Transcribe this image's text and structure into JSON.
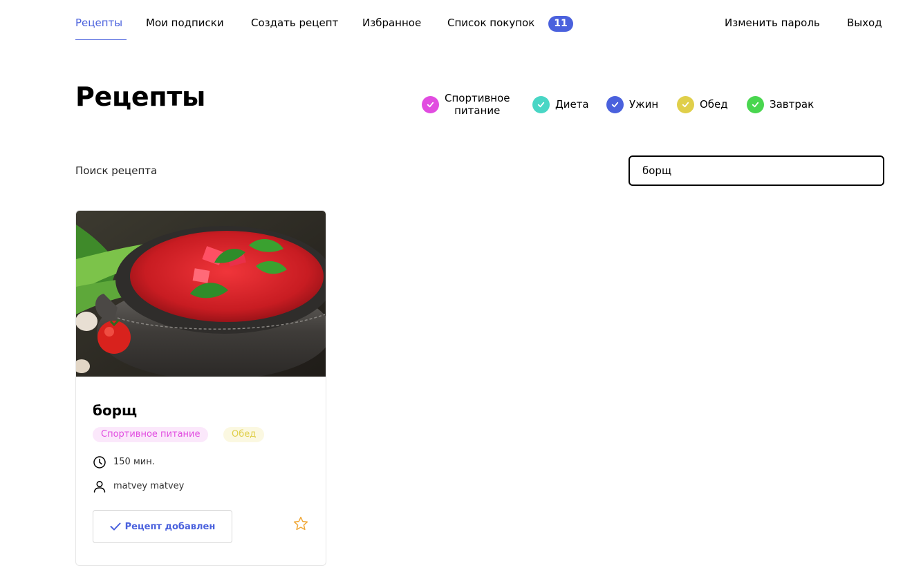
{
  "nav": {
    "recipes": "Рецепты",
    "subscriptions": "Мои подписки",
    "create_recipe": "Создать рецепт",
    "favorites": "Избранное",
    "shopping_list": "Список покупок",
    "shopping_count": "11",
    "change_password": "Изменить пароль",
    "logout": "Выход"
  },
  "page": {
    "title": "Рецепты"
  },
  "tags": [
    {
      "label_line1": "Спортивное",
      "label_line2": "питание",
      "color": "#e14ce0",
      "checked": true
    },
    {
      "label": "Диета",
      "color": "#49d6c5",
      "checked": true
    },
    {
      "label": "Ужин",
      "color": "#4a61dd",
      "checked": true
    },
    {
      "label": "Обед",
      "color": "#e0cf4a",
      "checked": true
    },
    {
      "label": "Завтрак",
      "color": "#49d64f",
      "checked": true
    }
  ],
  "search": {
    "label": "Поиск рецепта",
    "value": "борщ"
  },
  "recipe": {
    "title": "борщ",
    "tags": [
      "Спортивное питание",
      "Обед"
    ],
    "time": "150 мин.",
    "author": "matvey matvey",
    "added_label": "Рецепт добавлен",
    "image_icon": "borscht-photo"
  },
  "colors": {
    "accent": "#4a61dd",
    "star": "#f0a93a"
  }
}
